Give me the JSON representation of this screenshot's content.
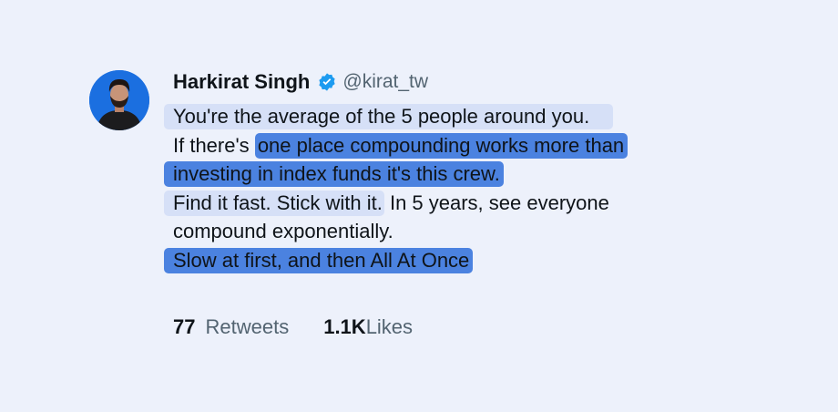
{
  "author": {
    "name": "Harkirat Singh",
    "handle": "@kirat_tw",
    "verified_icon": "verified-badge-icon",
    "verified_color": "#1d9bf0"
  },
  "tweet": {
    "lines": {
      "l1": "You're the average of the 5 people around you.",
      "l2_plain": "If there's",
      "l2_highlight": "one place compounding works more than",
      "l3": "investing in index funds it's this crew.",
      "l4_highlight": "Find it fast. Stick with it.",
      "l4_plain": " In 5 years, see everyone",
      "l5": "compound exponentially.",
      "l6": "Slow at first, and then All At Once"
    },
    "highlight_colors": {
      "light": "#d6e0f7",
      "dark": "#4b82e0"
    }
  },
  "stats": {
    "retweets_count": "77",
    "retweets_label": "Retweets",
    "likes_count": "1.1K",
    "likes_label": "Likes"
  }
}
